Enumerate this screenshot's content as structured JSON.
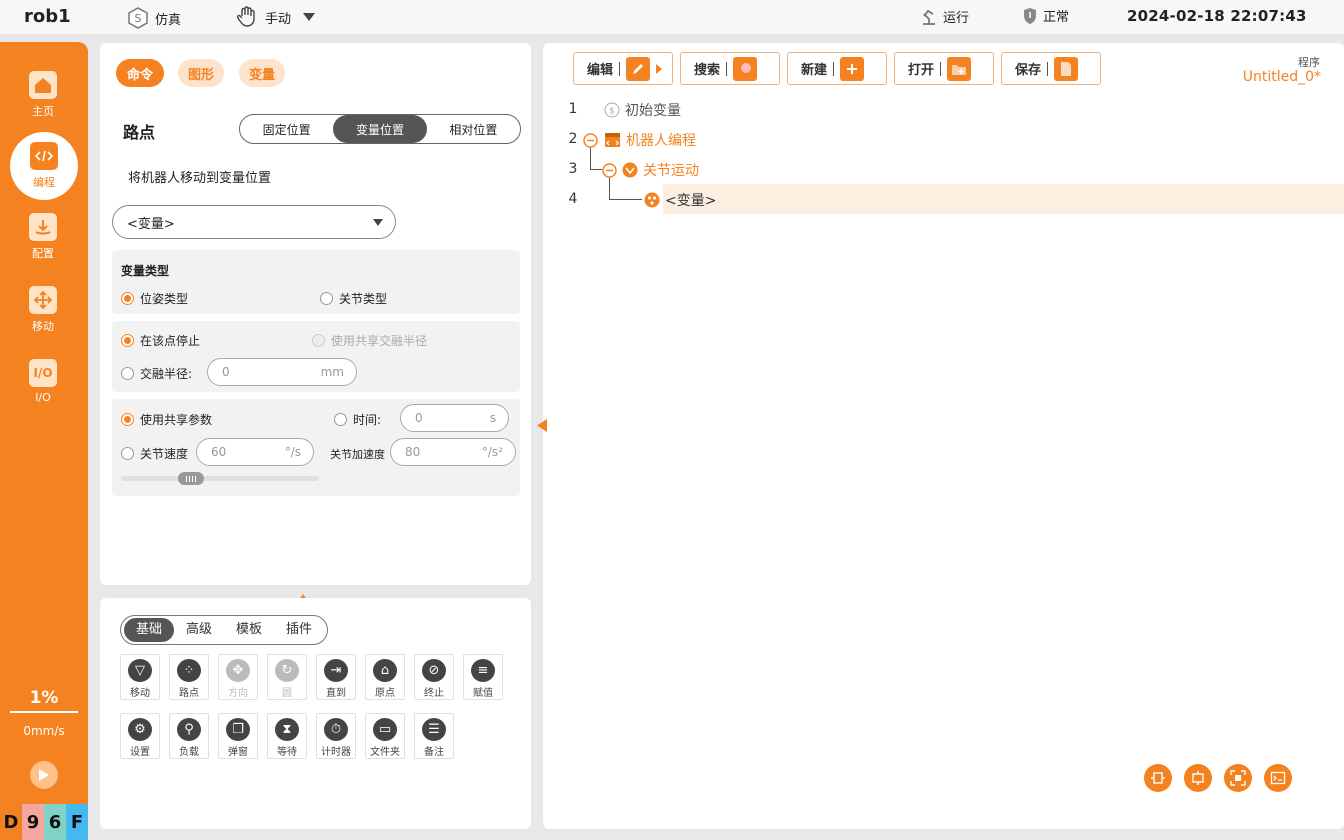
{
  "topbar": {
    "robot": "rob1",
    "sim_label": "仿真",
    "mode_label": "手动",
    "run_label": "运行",
    "status_label": "正常",
    "datetime": "2024-02-18 22:07:43"
  },
  "sidebar": {
    "items": [
      {
        "label": "主页",
        "icon": "home-icon"
      },
      {
        "label": "编程",
        "icon": "code-icon"
      },
      {
        "label": "配置",
        "icon": "download-icon"
      },
      {
        "label": "移动",
        "icon": "move-icon"
      },
      {
        "label": "I/O",
        "icon": "io-icon"
      }
    ],
    "speed_percent": "1%",
    "speed": "0mm/s",
    "codes": [
      "D",
      "9",
      "6",
      "F"
    ],
    "code_colors": [
      "#f58220",
      "#f6a5a0",
      "#7fd3c6",
      "#45b8f0"
    ]
  },
  "cmd_panel": {
    "tabs": [
      "命令",
      "图形",
      "变量"
    ],
    "title": "路点",
    "seg": [
      "固定位置",
      "变量位置",
      "相对位置"
    ],
    "desc": "将机器人移动到变量位置",
    "dropdown": "<变量>",
    "var_type_title": "变量类型",
    "pose_type": "位姿类型",
    "joint_type": "关节类型",
    "stop_here": "在该点停止",
    "shared_blend": "使用共享交融半径",
    "blend_radius": "交融半径:",
    "blend_value": "0",
    "blend_unit": "mm",
    "shared_params": "使用共享参数",
    "time_label": "时间:",
    "time_value": "0",
    "time_unit": "s",
    "joint_speed": "关节速度",
    "joint_speed_value": "60",
    "joint_speed_unit": "°/s",
    "joint_acc": "关节加速度",
    "joint_acc_value": "80",
    "joint_acc_unit": "°/s²"
  },
  "palette": {
    "tabs": [
      "基础",
      "高级",
      "模板",
      "插件"
    ],
    "row1": [
      "移动",
      "路点",
      "方向",
      "圆",
      "直到",
      "原点",
      "终止",
      "赋值"
    ],
    "row2": [
      "设置",
      "负载",
      "弹窗",
      "等待",
      "计时器",
      "文件夹",
      "备注"
    ]
  },
  "editor": {
    "toolbar": [
      "编辑",
      "搜索",
      "新建",
      "打开",
      "保存"
    ],
    "program_label": "程序",
    "program_name": "Untitled_0*",
    "lines": [
      {
        "no": "1",
        "text": "初始变量"
      },
      {
        "no": "2",
        "text": "机器人编程"
      },
      {
        "no": "3",
        "text": "关节运动"
      },
      {
        "no": "4",
        "text": "<变量>"
      }
    ],
    "accent": "#f58220"
  }
}
